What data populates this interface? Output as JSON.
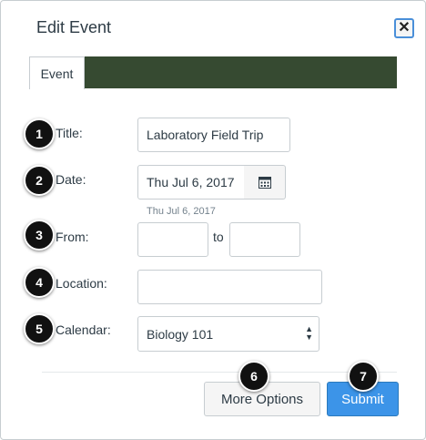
{
  "dialog": {
    "title": "Edit Event",
    "close_icon": "close-icon",
    "tabs": [
      {
        "label": "Event"
      }
    ],
    "tab_bar_color": "#364a31"
  },
  "form": {
    "title_label": "Title:",
    "title_value": "Laboratory Field Trip",
    "date_label": "Date:",
    "date_value": "Thu Jul 6, 2017",
    "date_hint": "Thu Jul 6, 2017",
    "calendar_icon": "calendar-icon",
    "from_label": "From:",
    "from_value": "",
    "to_label": "to",
    "to_value": "",
    "location_label": "Location:",
    "location_value": "",
    "calendar_label": "Calendar:",
    "calendar_value": "Biology 101"
  },
  "buttons": {
    "more_options": "More Options",
    "submit": "Submit"
  },
  "callouts": [
    "1",
    "2",
    "3",
    "4",
    "5",
    "6",
    "7"
  ],
  "colors": {
    "accent": "#3c94e8",
    "badge": "#111111"
  }
}
